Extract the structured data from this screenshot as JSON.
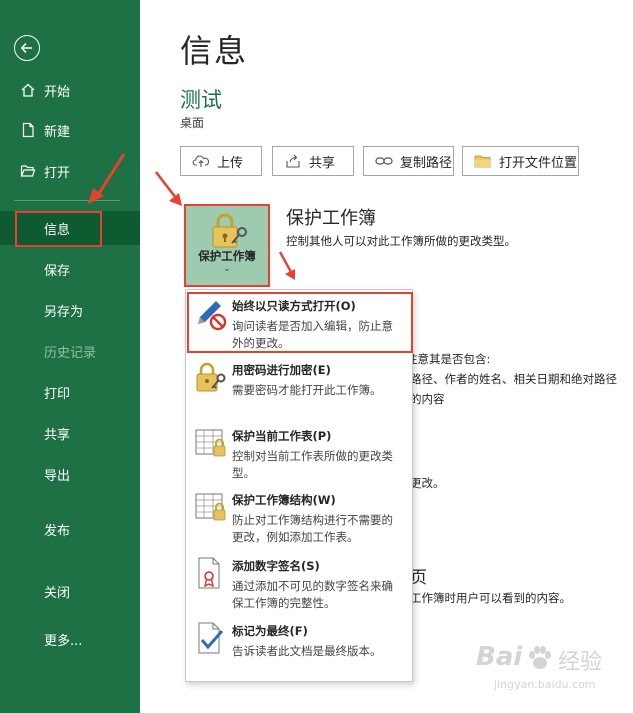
{
  "sidebar": {
    "items": [
      {
        "id": "home",
        "label": "开始"
      },
      {
        "id": "new",
        "label": "新建"
      },
      {
        "id": "open",
        "label": "打开"
      },
      {
        "id": "info",
        "label": "信息"
      },
      {
        "id": "save",
        "label": "保存"
      },
      {
        "id": "saveas",
        "label": "另存为"
      },
      {
        "id": "history",
        "label": "历史记录"
      },
      {
        "id": "print",
        "label": "打印"
      },
      {
        "id": "share",
        "label": "共享"
      },
      {
        "id": "export",
        "label": "导出"
      },
      {
        "id": "publish",
        "label": "发布"
      },
      {
        "id": "close",
        "label": "关闭"
      },
      {
        "id": "more",
        "label": "更多..."
      }
    ]
  },
  "main": {
    "title": "信息",
    "doc_name": "测试",
    "doc_location": "桌面",
    "toolbar": {
      "upload": "上传",
      "share": "共享",
      "copy_path": "复制路径",
      "open_location": "打开文件位置"
    },
    "protect": {
      "button_label": "保护工作簿",
      "chevron": "⌄",
      "section_title": "保护工作簿",
      "section_desc": "控制其他人可以对此工作簿所做的更改类型。"
    },
    "background_text": {
      "line1": "注意其是否包含:",
      "line2": "路径、作者的姓名、相关日期和绝对路径",
      "line3": "的内容",
      "line4": "更改。",
      "line5": "页",
      "line6": "工作簿时用户可以看到的内容。"
    }
  },
  "dropdown": {
    "items": [
      {
        "title": "始终以只读方式打开(O)",
        "desc": "询问读者是否加入编辑，防止意外的更改。"
      },
      {
        "title": "用密码进行加密(E)",
        "desc": "需要密码才能打开此工作簿。"
      },
      {
        "title": "保护当前工作表(P)",
        "desc": "控制对当前工作表所做的更改类型。"
      },
      {
        "title": "保护工作簿结构(W)",
        "desc": "防止对工作簿结构进行不需要的更改，例如添加工作表。"
      },
      {
        "title": "添加数字签名(S)",
        "desc": "通过添加不可见的数字签名来确保工作簿的完整性。"
      },
      {
        "title": "标记为最终(F)",
        "desc": "告诉读者此文档是最终版本。"
      }
    ]
  },
  "watermark": {
    "brand": "Bai",
    "brand2": "经验",
    "url": "jingyan.baidu.com"
  },
  "colors": {
    "sidebar": "#1e7145",
    "active": "#0e5a31",
    "accent_green": "#1e7145",
    "highlight_red": "#e8412f",
    "protect_button": "#9ccbb0"
  }
}
